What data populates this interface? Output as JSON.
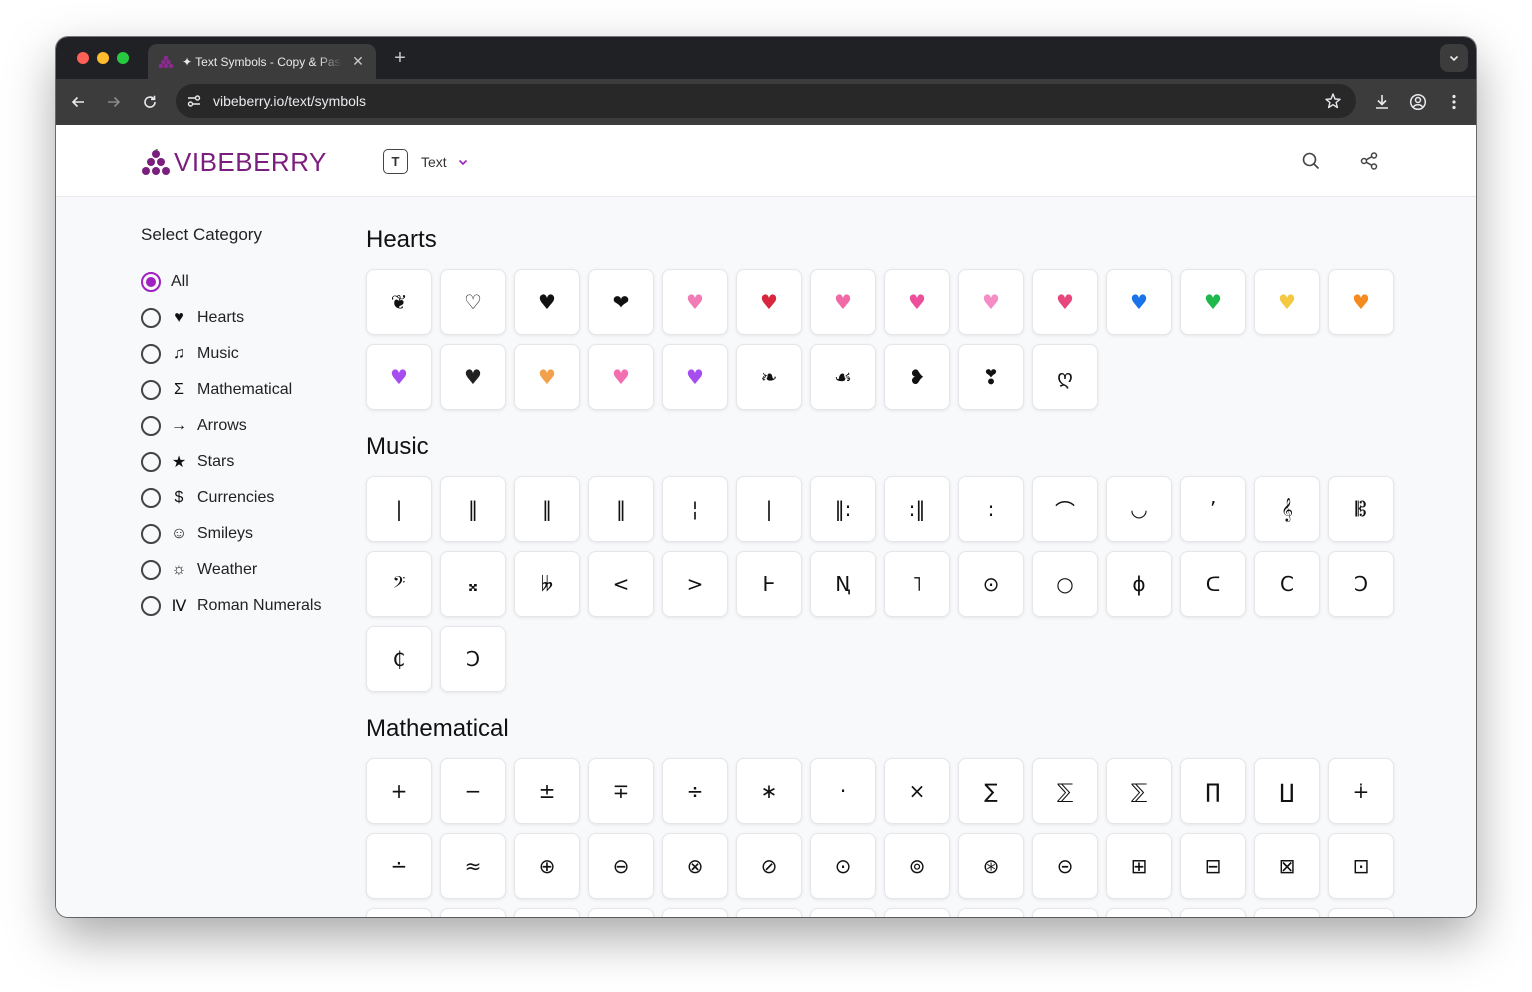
{
  "browser": {
    "tab_title": "✦ Text Symbols - Copy & Paste",
    "tab_close": "✕",
    "new_tab": "+",
    "url": "vibeberry.io/text/symbols"
  },
  "header": {
    "logo_text": "VIBEBERRY",
    "menu_label": "Text",
    "menu_icon_letter": "T"
  },
  "sidebar": {
    "title": "Select Category",
    "items": [
      {
        "label": "All",
        "icon": "",
        "selected": true
      },
      {
        "label": "Hearts",
        "icon": "heart-icon",
        "glyph": "♥"
      },
      {
        "label": "Music",
        "icon": "music-note-icon",
        "glyph": "♫"
      },
      {
        "label": "Mathematical",
        "icon": "sigma-icon",
        "glyph": "Σ"
      },
      {
        "label": "Arrows",
        "icon": "arrow-right-icon",
        "glyph": "→"
      },
      {
        "label": "Stars",
        "icon": "star-icon",
        "glyph": "★"
      },
      {
        "label": "Currencies",
        "icon": "dollar-icon",
        "glyph": "$"
      },
      {
        "label": "Smileys",
        "icon": "smiley-icon",
        "glyph": "☺"
      },
      {
        "label": "Weather",
        "icon": "weather-icon",
        "glyph": "☼"
      },
      {
        "label": "Roman Numerals",
        "icon": "roman-numeral-icon",
        "glyph": "Ⅳ"
      }
    ]
  },
  "sections": [
    {
      "title": "Hearts",
      "symbols": [
        {
          "glyph": "❦",
          "color": "#111111"
        },
        {
          "glyph": "♡",
          "color": "#111111"
        },
        {
          "glyph": "♥",
          "color": "#111111"
        },
        {
          "glyph": "❤",
          "color": "#111111"
        },
        {
          "glyph": "♥",
          "color": "#f17bb4"
        },
        {
          "glyph": "♥",
          "color": "#d7263d"
        },
        {
          "glyph": "♥",
          "color": "#f06aa8"
        },
        {
          "glyph": "♥",
          "color": "#ee4f9a"
        },
        {
          "glyph": "♥",
          "color": "#f58cc6"
        },
        {
          "glyph": "♥",
          "color": "#e8477d"
        },
        {
          "glyph": "♥",
          "color": "#1a73e8"
        },
        {
          "glyph": "♥",
          "color": "#1fb84c"
        },
        {
          "glyph": "♥",
          "color": "#f5c842"
        },
        {
          "glyph": "♥",
          "color": "#f58a1f"
        },
        {
          "glyph": "♥",
          "color": "#a64df0"
        },
        {
          "glyph": "♥",
          "color": "#222222"
        },
        {
          "glyph": "♥",
          "color": "#f2a14a"
        },
        {
          "glyph": "♥",
          "color": "#f36eb1"
        },
        {
          "glyph": "♥",
          "color": "#a64df0"
        },
        {
          "glyph": "❧",
          "color": "#111111"
        },
        {
          "glyph": "☙",
          "color": "#111111"
        },
        {
          "glyph": "❥",
          "color": "#111111"
        },
        {
          "glyph": "❣",
          "color": "#111111"
        },
        {
          "glyph": "ღ",
          "color": "#111111"
        }
      ]
    },
    {
      "title": "Music",
      "symbols": [
        {
          "glyph": "|"
        },
        {
          "glyph": "‖"
        },
        {
          "glyph": "‖"
        },
        {
          "glyph": "‖"
        },
        {
          "glyph": "¦"
        },
        {
          "glyph": "|"
        },
        {
          "glyph": "‖:"
        },
        {
          "glyph": ":‖"
        },
        {
          "glyph": ":"
        },
        {
          "glyph": "⌒"
        },
        {
          "glyph": "◡"
        },
        {
          "glyph": "’"
        },
        {
          "glyph": "𝄞"
        },
        {
          "glyph": "𝄡"
        },
        {
          "glyph": "𝄢"
        },
        {
          "glyph": "𝄪"
        },
        {
          "glyph": "𝄫"
        },
        {
          "glyph": "<"
        },
        {
          "glyph": ">"
        },
        {
          "glyph": "Ⱶ"
        },
        {
          "glyph": "Ꞑ"
        },
        {
          "glyph": "˥"
        },
        {
          "glyph": "⊙"
        },
        {
          "glyph": "○"
        },
        {
          "glyph": "ɸ"
        },
        {
          "glyph": "ᑕ"
        },
        {
          "glyph": "C"
        },
        {
          "glyph": "Ↄ"
        },
        {
          "glyph": "₵"
        },
        {
          "glyph": "Ↄ"
        }
      ]
    },
    {
      "title": "Mathematical",
      "symbols": [
        {
          "glyph": "+"
        },
        {
          "glyph": "−"
        },
        {
          "glyph": "±"
        },
        {
          "glyph": "∓"
        },
        {
          "glyph": "÷"
        },
        {
          "glyph": "∗"
        },
        {
          "glyph": "·"
        },
        {
          "glyph": "×"
        },
        {
          "glyph": "∑"
        },
        {
          "glyph": "⅀"
        },
        {
          "glyph": "⅀"
        },
        {
          "glyph": "∏"
        },
        {
          "glyph": "∐"
        },
        {
          "glyph": "∔"
        },
        {
          "glyph": "∸"
        },
        {
          "glyph": "≈"
        },
        {
          "glyph": "⊕"
        },
        {
          "glyph": "⊖"
        },
        {
          "glyph": "⊗"
        },
        {
          "glyph": "⊘"
        },
        {
          "glyph": "⊙"
        },
        {
          "glyph": "⊚"
        },
        {
          "glyph": "⊛"
        },
        {
          "glyph": "⊝"
        },
        {
          "glyph": "⊞"
        },
        {
          "glyph": "⊟"
        },
        {
          "glyph": "⊠"
        },
        {
          "glyph": "⊡"
        },
        {
          "glyph": ""
        },
        {
          "glyph": ""
        },
        {
          "glyph": ""
        },
        {
          "glyph": ""
        },
        {
          "glyph": ""
        },
        {
          "glyph": ""
        },
        {
          "glyph": ""
        },
        {
          "glyph": ""
        },
        {
          "glyph": ""
        },
        {
          "glyph": ""
        },
        {
          "glyph": ""
        },
        {
          "glyph": ""
        },
        {
          "glyph": ""
        },
        {
          "glyph": ""
        }
      ]
    }
  ]
}
